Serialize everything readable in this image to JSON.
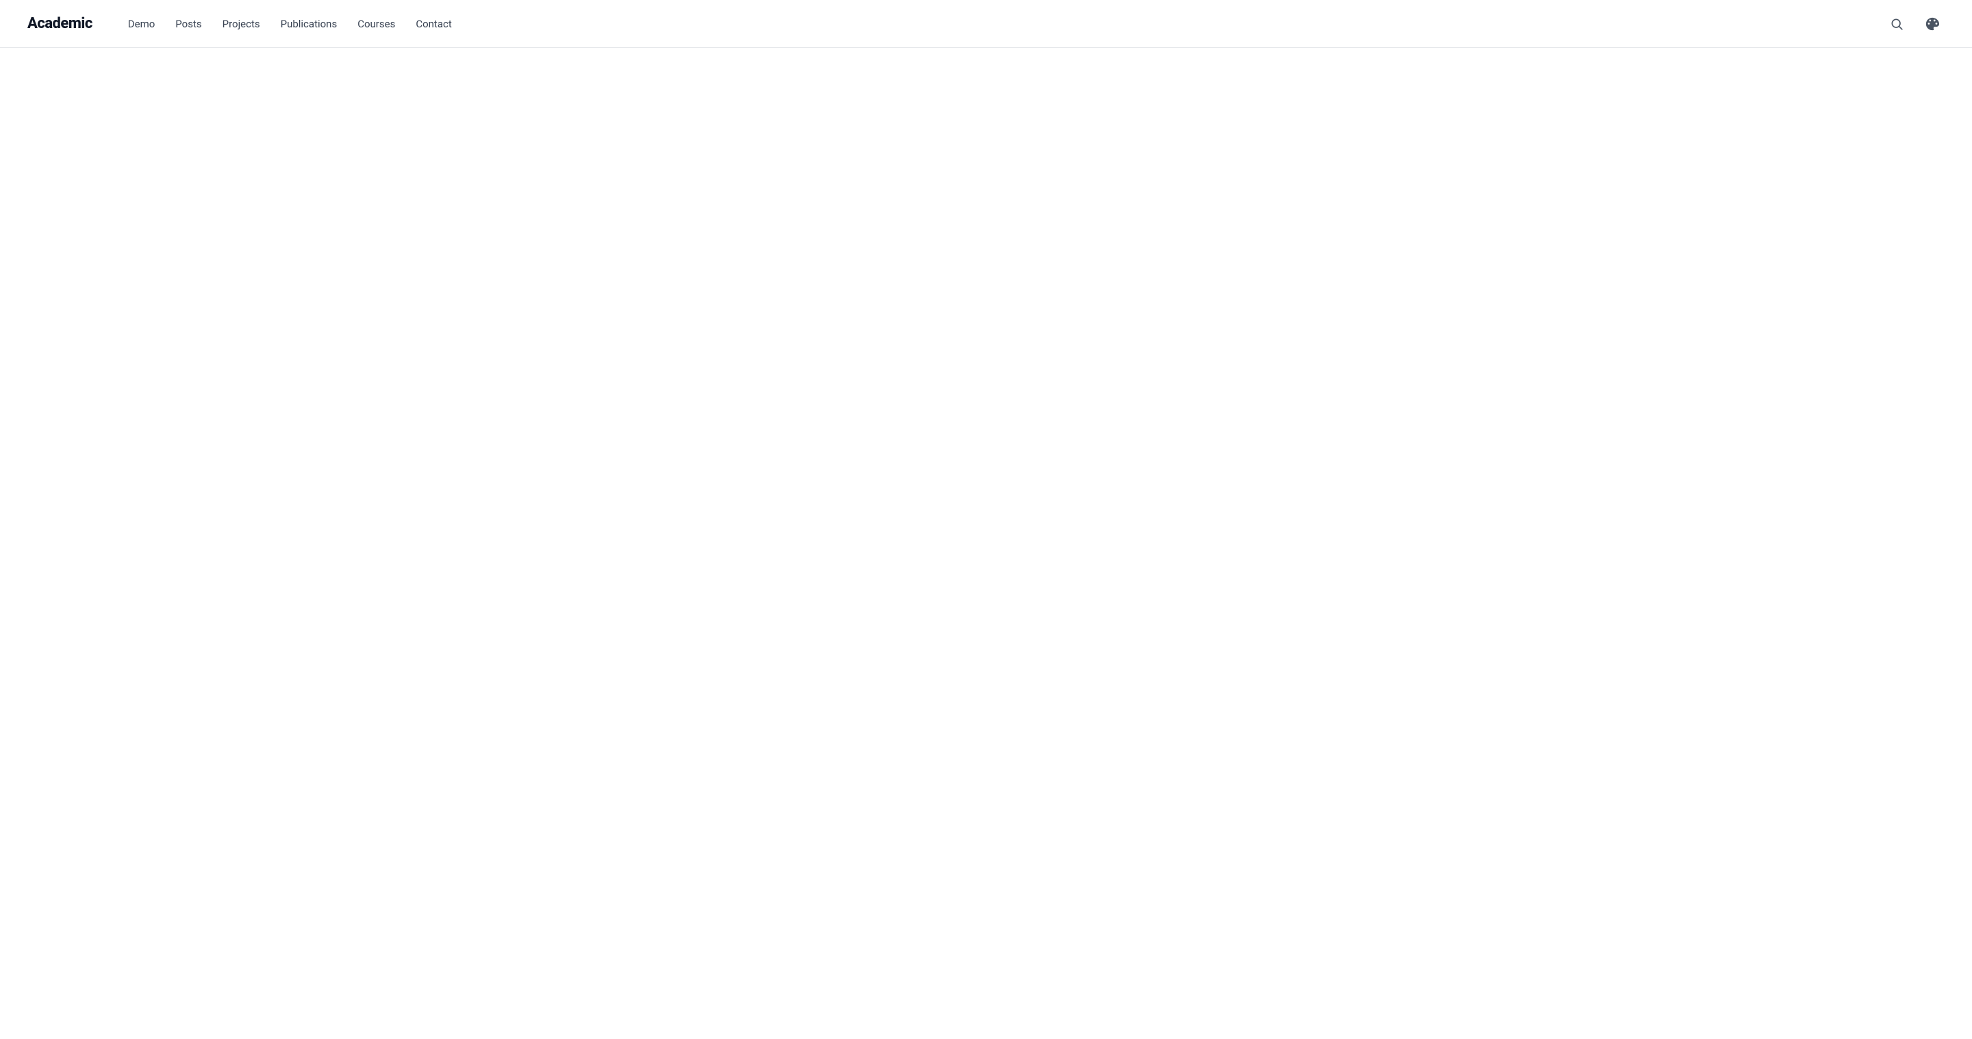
{
  "site": {
    "title": "Academic"
  },
  "nav": {
    "items": [
      {
        "label": "Demo",
        "href": "#"
      },
      {
        "label": "Posts",
        "href": "#"
      },
      {
        "label": "Projects",
        "href": "#"
      },
      {
        "label": "Publications",
        "href": "#"
      },
      {
        "label": "Courses",
        "href": "#"
      },
      {
        "label": "Contact",
        "href": "#"
      }
    ]
  },
  "header": {
    "search_label": "Search",
    "theme_label": "Theme"
  }
}
